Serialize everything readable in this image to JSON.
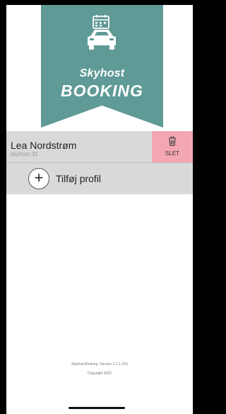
{
  "header": {
    "brand_top": "Skyhost",
    "brand_bottom": "BOOKING",
    "logo_icon": "car-calendar-icon",
    "banner_color": "#5f9a97"
  },
  "profiles": [
    {
      "name": "Lea Nordstrøm",
      "id": "skyhost-31",
      "delete_label": "SLET",
      "delete_icon": "trash-icon",
      "delete_color": "#f4a6b3"
    }
  ],
  "add_profile": {
    "label": "Tilføj profil",
    "icon": "plus-icon"
  },
  "footer": {
    "version": "Skyhost Booking -Version  1.1.1 (24)",
    "copyright": "Copyright 2022"
  }
}
